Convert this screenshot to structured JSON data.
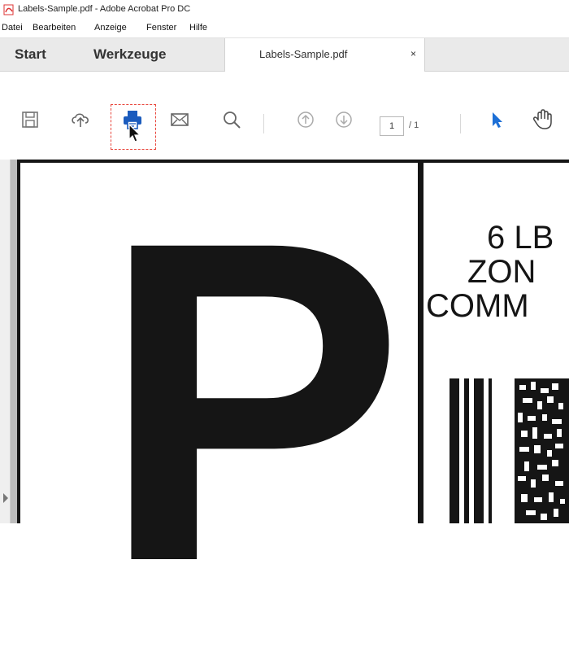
{
  "window": {
    "title": "Labels-Sample.pdf - Adobe Acrobat Pro DC"
  },
  "menu": {
    "items": [
      "Datei",
      "Bearbeiten",
      "Anzeige",
      "Fenster",
      "Hilfe"
    ]
  },
  "tabs": {
    "start": "Start",
    "tools": "Werkzeuge",
    "document": "Labels-Sample.pdf",
    "close": "×"
  },
  "toolbar": {
    "icons": [
      "save-icon",
      "upload-cloud-icon",
      "print-icon",
      "email-icon",
      "search-icon",
      "page-up-icon",
      "page-down-icon",
      "select-arrow-icon",
      "hand-tool-icon"
    ],
    "highlighted": "print-icon",
    "page_current": "1",
    "page_total": "/ 1"
  },
  "document": {
    "big_letter": "P",
    "lines": [
      "6 LB",
      "ZON",
      "COMM"
    ]
  },
  "colors": {
    "accent_blue": "#1d6fd6",
    "print_blue": "#1b5bbd",
    "highlight_red": "#e8443a",
    "label_black": "#151515"
  }
}
